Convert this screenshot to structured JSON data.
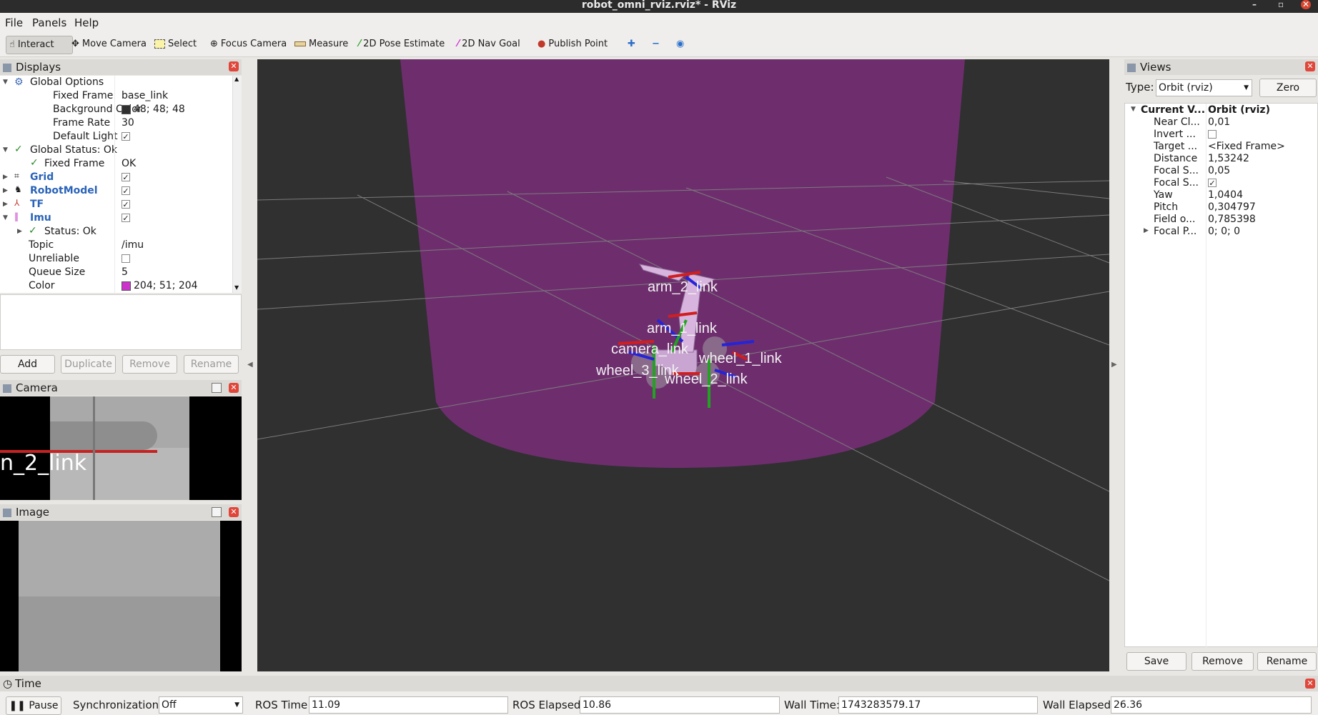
{
  "window": {
    "title": "robot_omni_rviz.rviz* - RViz"
  },
  "menu": {
    "file": "File",
    "panels": "Panels",
    "help": "Help"
  },
  "toolbar": {
    "interact": "Interact",
    "move_camera": "Move Camera",
    "select": "Select",
    "focus_camera": "Focus Camera",
    "measure": "Measure",
    "pose_estimate": "2D Pose Estimate",
    "nav_goal": "2D Nav Goal",
    "publish_point": "Publish Point"
  },
  "displays": {
    "title": "Displays",
    "global_options": "Global Options",
    "fixed_frame_label": "Fixed Frame",
    "fixed_frame_value": "base_link",
    "background_color_label": "Background Color",
    "background_color_value": "48; 48; 48",
    "background_color_hex": "#303030",
    "frame_rate_label": "Frame Rate",
    "frame_rate_value": "30",
    "default_light_label": "Default Light",
    "global_status": "Global Status: Ok",
    "status_fixed_frame_label": "Fixed Frame",
    "status_fixed_frame_value": "OK",
    "grid": "Grid",
    "robot_model": "RobotModel",
    "tf": "TF",
    "imu": "Imu",
    "imu_status": "Status: Ok",
    "topic_label": "Topic",
    "topic_value": "/imu",
    "unreliable_label": "Unreliable",
    "queue_size_label": "Queue Size",
    "queue_size_value": "5",
    "color_label": "Color",
    "color_value": "204; 51; 204",
    "color_hex": "#cc33cc",
    "add": "Add",
    "duplicate": "Duplicate",
    "remove": "Remove",
    "rename": "Rename"
  },
  "camera_panel": {
    "title": "Camera",
    "overlay_text": "n_2_link"
  },
  "image_panel": {
    "title": "Image"
  },
  "scene_labels": {
    "arm2": "arm_2_link",
    "arm1": "arm_1_link",
    "camera": "camera_link",
    "wheel3": "wheel_3_link",
    "wheel2": "wheel_2_link",
    "wheel1": "wheel_1_link"
  },
  "views": {
    "title": "Views",
    "type_label": "Type:",
    "type_value": "Orbit (rviz)",
    "zero": "Zero",
    "current_view_label": "Current V...",
    "current_view_value": "Orbit (rviz)",
    "near_clip_label": "Near Cl...",
    "near_clip_value": "0,01",
    "invert_label": "Invert ...",
    "target_label": "Target ...",
    "target_value": "<Fixed Frame>",
    "distance_label": "Distance",
    "distance_value": "1,53242",
    "focal_size_label": "Focal S...",
    "focal_size_value": "0,05",
    "focal_shape_label": "Focal S...",
    "yaw_label": "Yaw",
    "yaw_value": "1,0404",
    "pitch_label": "Pitch",
    "pitch_value": "0,304797",
    "fov_label": "Field o...",
    "fov_value": "0,785398",
    "focal_point_label": "Focal P...",
    "focal_point_value": "0; 0; 0",
    "save": "Save",
    "remove": "Remove",
    "rename": "Rename"
  },
  "time": {
    "title": "Time",
    "pause": "Pause",
    "sync_label": "Synchronization:",
    "sync_value": "Off",
    "ros_time_label": "ROS Time:",
    "ros_time_value": "11.09",
    "ros_elapsed_label": "ROS Elapsed:",
    "ros_elapsed_value": "10.86",
    "wall_time_label": "Wall Time:",
    "wall_time_value": "1743283579.17",
    "wall_elapsed_label": "Wall Elapsed:",
    "wall_elapsed_value": "26.36"
  }
}
